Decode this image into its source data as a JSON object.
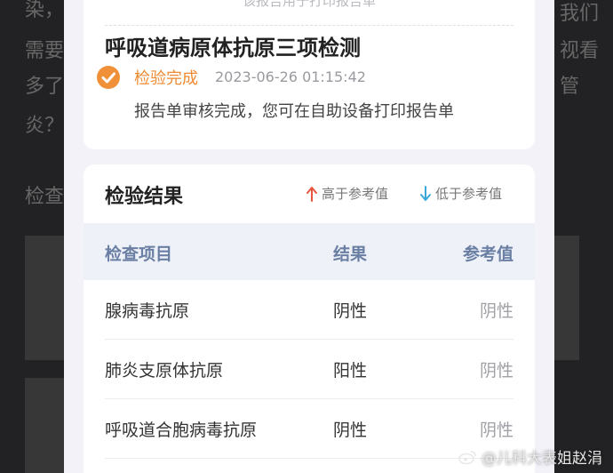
{
  "background": {
    "text_lines": [
      "染，",
      "需要",
      "多了",
      "炎？",
      "检查"
    ],
    "right_fragments": [
      "我们",
      "视看",
      "管"
    ]
  },
  "report": {
    "faded_header": "该报告用于打印报告单",
    "test_name": "呼吸道病原体抗原三项检测",
    "status_label": "检验完成",
    "status_time": "2023-06-26 01:15:42",
    "status_desc": "报告单审核完成，您可在自助设备打印报告单"
  },
  "results": {
    "title": "检验结果",
    "legend_high": "高于参考值",
    "legend_low": "低于参考值",
    "columns": {
      "item": "检查项目",
      "result": "结果",
      "reference": "参考值"
    },
    "rows": [
      {
        "item": "腺病毒抗原",
        "result": "阴性",
        "reference": "阴性"
      },
      {
        "item": "肺炎支原体抗原",
        "result": "阳性",
        "reference": "阴性"
      },
      {
        "item": "呼吸道合胞病毒抗原",
        "result": "阴性",
        "reference": "阴性"
      }
    ]
  },
  "colors": {
    "status_orange": "#ef8a32",
    "high_arrow": "#e8553f",
    "low_arrow": "#3aa8d8",
    "header_text": "#6a7fa3"
  },
  "watermark": "@儿科大表姐赵涓"
}
